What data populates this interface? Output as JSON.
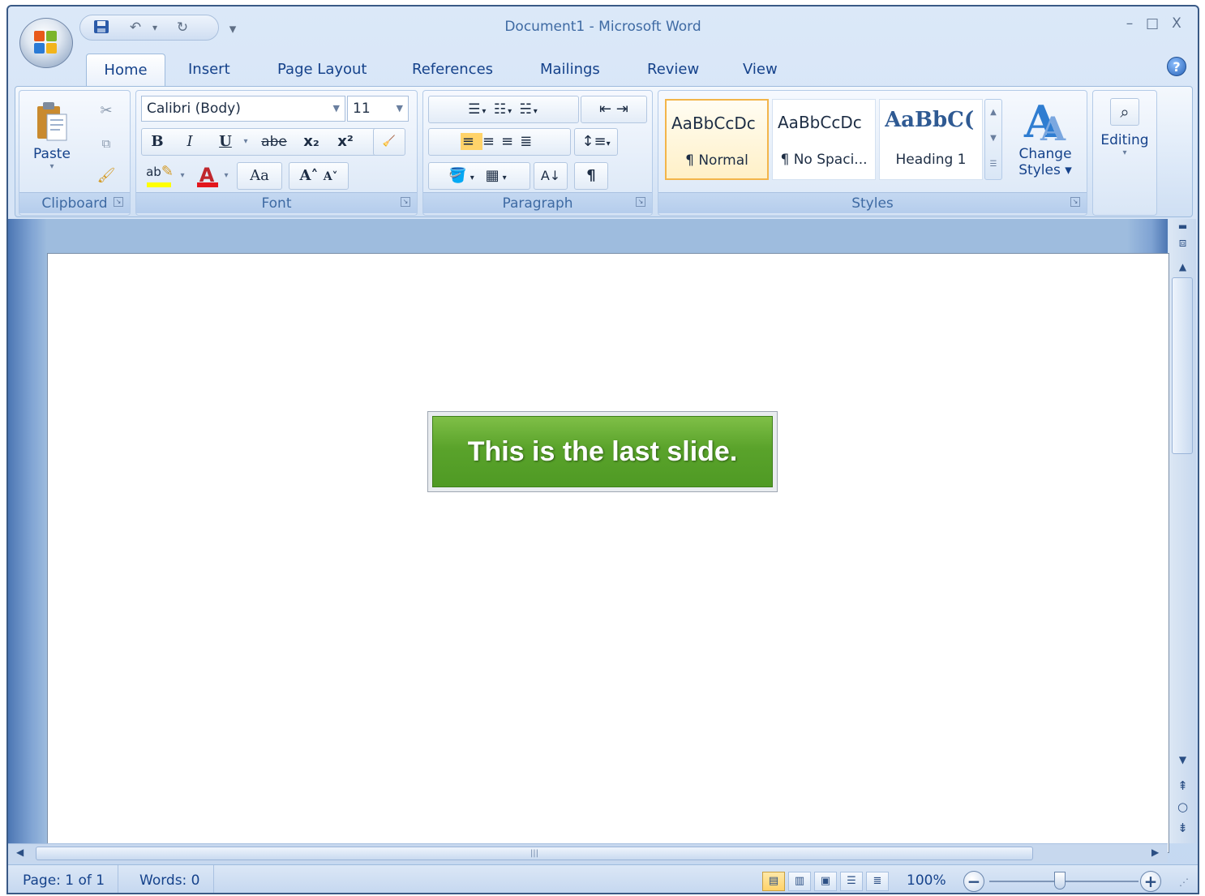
{
  "window": {
    "title": "Document1 - Microsoft Word",
    "controls": {
      "minimize": "–",
      "maximize": "□",
      "close": "X"
    }
  },
  "quick_access": {
    "customize_glyph": "▾"
  },
  "tabs": [
    {
      "label": "Home",
      "active": true
    },
    {
      "label": "Insert"
    },
    {
      "label": "Page Layout"
    },
    {
      "label": "References"
    },
    {
      "label": "Mailings"
    },
    {
      "label": "Review"
    },
    {
      "label": "View"
    }
  ],
  "ribbon": {
    "clipboard": {
      "label": "Clipboard",
      "paste_label": "Paste"
    },
    "font": {
      "label": "Font",
      "font_name": "Calibri (Body)",
      "font_size": "11",
      "bold": "B",
      "italic": "I",
      "underline": "U",
      "strikethrough": "abe",
      "subscript": "x₂",
      "superscript": "x²",
      "change_case": "Aa",
      "grow": "A˄",
      "shrink": "A˅",
      "font_color_letter": "A",
      "highlight_letters": "ab"
    },
    "paragraph": {
      "label": "Paragraph",
      "pilcrow": "¶"
    },
    "styles": {
      "label": "Styles",
      "items": [
        {
          "sample": "AaBbCcDc",
          "name": "¶ Normal",
          "selected": true
        },
        {
          "sample": "AaBbCcDc",
          "name": "¶ No Spaci..."
        },
        {
          "sample": "AaBbC(",
          "name": "Heading 1"
        }
      ],
      "change_styles_line1": "Change",
      "change_styles_line2": "Styles ▾"
    },
    "editing": {
      "label": "Editing"
    }
  },
  "document": {
    "slide_text": "This is the last slide."
  },
  "status": {
    "page": "Page: 1 of 1",
    "words": "Words: 0",
    "zoom": "100%"
  },
  "colors": {
    "accent": "#15428b",
    "slide_green": "#5aa32b",
    "ribbon_bg": "#dde9f8"
  }
}
